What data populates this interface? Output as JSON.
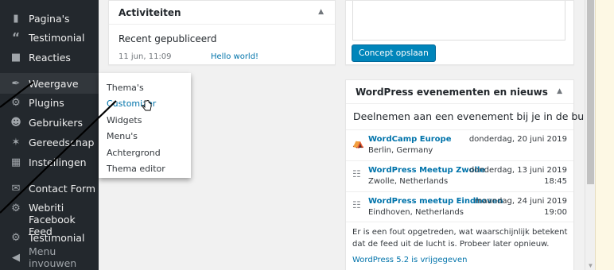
{
  "sidebar": {
    "items": [
      {
        "label": "Pagina's",
        "icon": "page-icon"
      },
      {
        "label": "Testimonial",
        "icon": "quote-icon"
      },
      {
        "label": "Reacties",
        "icon": "comment-icon"
      },
      {
        "label": "Weergave",
        "icon": "brush-icon"
      },
      {
        "label": "Plugins",
        "icon": "plugin-icon"
      },
      {
        "label": "Gebruikers",
        "icon": "users-icon"
      },
      {
        "label": "Gereedschap",
        "icon": "wrench-icon"
      },
      {
        "label": "Instellingen",
        "icon": "settings-icon"
      },
      {
        "label": "Contact Form",
        "icon": "mail-icon"
      },
      {
        "label": "Webriti Facebook Feed",
        "icon": "gear-icon"
      },
      {
        "label": "Testimonial",
        "icon": "gear-icon"
      },
      {
        "label": "Menu invouwen",
        "icon": "collapse-icon"
      }
    ]
  },
  "flyout": {
    "items": [
      "Thema's",
      "Customizer",
      "Widgets",
      "Menu's",
      "Achtergrond",
      "Thema editor"
    ]
  },
  "activity": {
    "title": "Activiteiten",
    "recent_label": "Recent gepubliceerd",
    "date": "11 jun, 11:09",
    "post_link": "Hello world!"
  },
  "draft": {
    "button_label": "Concept opslaan"
  },
  "events": {
    "title": "WordPress evenementen en nieuws",
    "intro": "Deelnemen aan een evenement bij je in de buurt.",
    "items": [
      {
        "title": "WordCamp Europe",
        "location": "Berlin, Germany",
        "date": "donderdag, 20 juni 2019",
        "time": "",
        "icon": "wordcamp-icon"
      },
      {
        "title": "WordPress Meetup Zwolle",
        "location": "Zwolle, Netherlands",
        "date": "donderdag, 13 juni 2019",
        "time": "18:45",
        "icon": "meetup-icon"
      },
      {
        "title": "WordPress meetup Eindhoven",
        "location": "Eindhoven, Netherlands",
        "date": "maandag, 24 juni 2019",
        "time": "19:00",
        "icon": "meetup-icon"
      }
    ],
    "error_text": "Er is een fout opgetreden, wat waarschijnlijk betekent dat de feed uit de lucht is. Probeer later opnieuw.",
    "news_link": "WordPress 5.2 is vrijgegeven"
  },
  "colors": {
    "sidebar_bg": "#23282d",
    "accent": "#0073aa",
    "button": "#0085ba"
  }
}
